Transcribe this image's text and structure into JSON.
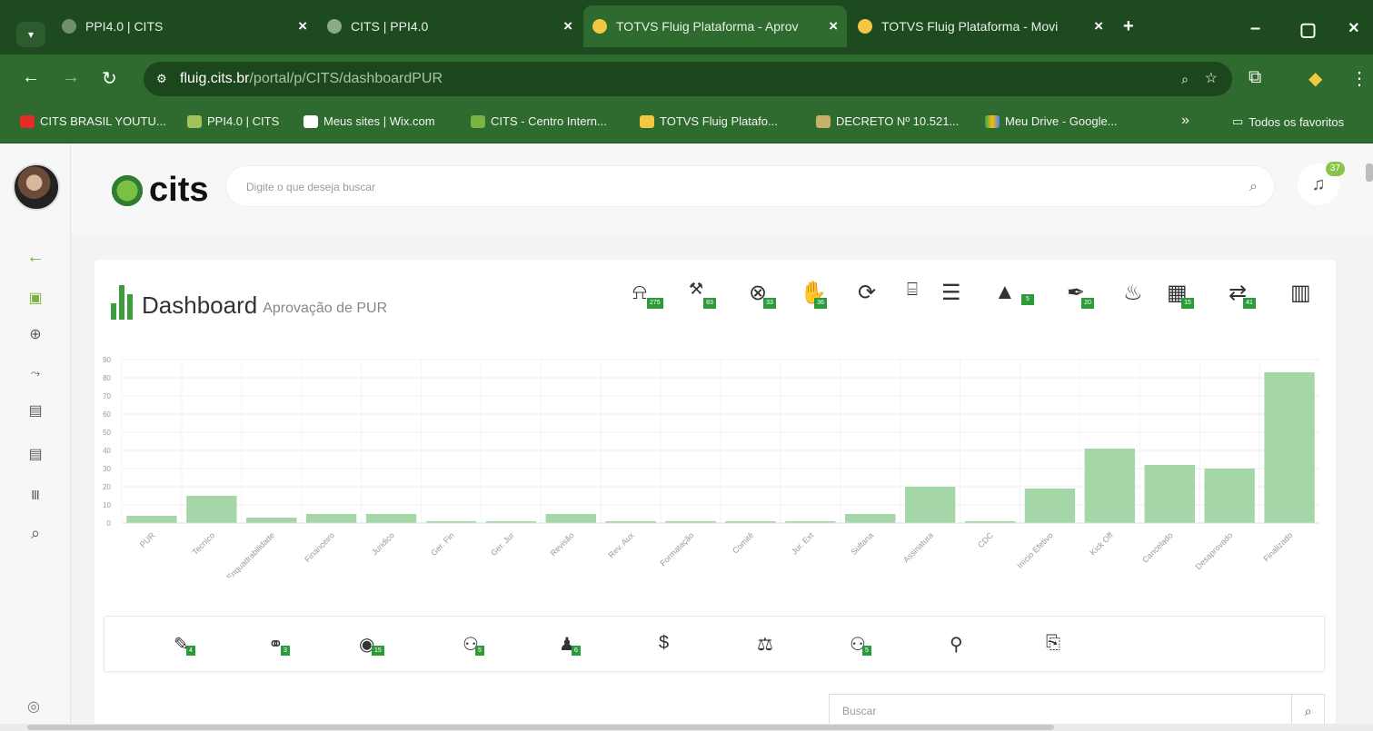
{
  "browser": {
    "tabs": [
      {
        "label": "PPI4.0 | CITS",
        "active": false
      },
      {
        "label": "CITS | PPI4.0",
        "active": false
      },
      {
        "label": "TOTVS Fluig Plataforma - Aprov",
        "active": true
      },
      {
        "label": "TOTVS Fluig Plataforma - Movi",
        "active": false
      }
    ],
    "new_tab": "+",
    "close": "×",
    "url_host": "fluig.cits.br",
    "url_path": "/portal/p/CITS/dashboardPUR",
    "bookmarks": [
      "CITS BRASIL YOUTU...",
      "PPI4.0 | CITS",
      "Meus sites | Wix.com",
      "CITS - Centro Intern...",
      "TOTVS Fluig Platafo...",
      "DECRETO Nº 10.521...",
      "Meu Drive - Google..."
    ],
    "more_bookmarks": "»",
    "all_favorites": "Todos os favoritos"
  },
  "header": {
    "logo_text": "cits",
    "search_placeholder": "Digite o que deseja buscar",
    "notifications_count": "37"
  },
  "dashboard": {
    "title": "Dashboard",
    "subtitle": "Aprovação de PUR",
    "toolbar_badges": [
      "275",
      "83",
      "33",
      "36",
      "5",
      "20",
      "15",
      "41"
    ]
  },
  "chart_data": {
    "type": "bar",
    "categories": [
      "PUR",
      "Tecnico",
      "Enquadrabilidade",
      "Financeiro",
      "Juridico",
      "Ger. Fin",
      "Ger. Jur",
      "Revisão",
      "Rev. Aux",
      "Formatação",
      "Comitê",
      "Jur. Ext",
      "Sultana",
      "Assinatura",
      "CDC",
      "Início Efetivo",
      "Kick Off",
      "Cancelado",
      "Desaprovado",
      "Finalizado"
    ],
    "values": [
      4,
      15,
      3,
      5,
      5,
      1,
      1,
      5,
      1,
      1,
      1,
      1,
      5,
      20,
      1,
      19,
      41,
      32,
      30,
      83
    ],
    "ylim": [
      0,
      90
    ],
    "yticks": [
      "0",
      "10",
      "20",
      "30",
      "40",
      "50",
      "60",
      "70",
      "80",
      "90"
    ],
    "color": "#a5d6a7",
    "grid": true
  },
  "strip": {
    "badges": [
      "4",
      "3",
      "15",
      "5",
      "6",
      "",
      "",
      "5",
      "",
      ""
    ]
  },
  "footer": {
    "search_placeholder": "Buscar"
  }
}
